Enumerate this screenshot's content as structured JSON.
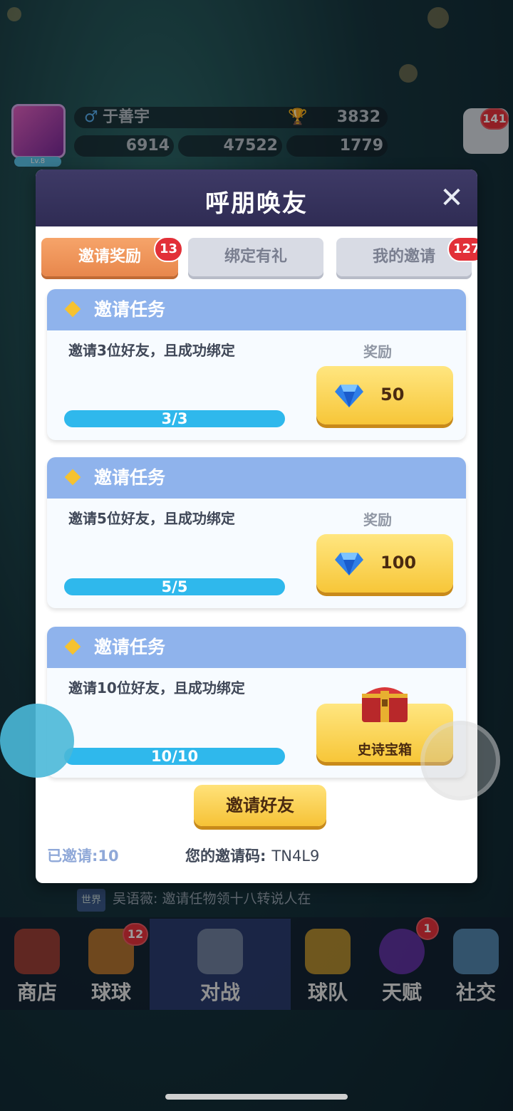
{
  "hud": {
    "player_name": "于善宇",
    "trophies": "3832",
    "level": "Lv.8",
    "currency1": "6914",
    "currency2": "47522",
    "gems": "1779",
    "menu_badge": "141"
  },
  "modal": {
    "title": "呼朋唤友",
    "close_icon": "close-icon",
    "tabs": [
      {
        "label": "邀请奖励",
        "badge": "13",
        "active": true
      },
      {
        "label": "绑定有礼",
        "badge": "",
        "active": false
      },
      {
        "label": "我的邀请",
        "badge": "127",
        "active": false
      }
    ],
    "tasks": [
      {
        "title": "邀请任务",
        "desc": "邀请3位好友，且成功绑定",
        "reward_label": "奖励",
        "progress": "3/3",
        "progress_fraction": 1.0,
        "reward_amount": "50",
        "reward_icon": "gem-icon"
      },
      {
        "title": "邀请任务",
        "desc": "邀请5位好友，且成功绑定",
        "reward_label": "奖励",
        "progress": "5/5",
        "progress_fraction": 1.0,
        "reward_amount": "100",
        "reward_icon": "gem-icon"
      },
      {
        "title": "邀请任务",
        "desc": "邀请10位好友，且成功绑定",
        "reward_label": "",
        "progress": "10/10",
        "progress_fraction": 1.0,
        "reward_amount": "史诗宝箱",
        "reward_icon": "chest-icon"
      }
    ],
    "invite_button": "邀请好友",
    "invited_label": "已邀请:10",
    "invite_code_label": "您的邀请码:",
    "invite_code": "TN4L9"
  },
  "chat": {
    "tag": "世界",
    "text": "吴语薇: 邀请任物领十八转说人在"
  },
  "nav": [
    {
      "label": "商店",
      "badge": ""
    },
    {
      "label": "球球",
      "badge": "12"
    },
    {
      "label": "对战",
      "badge": ""
    },
    {
      "label": "球队",
      "badge": ""
    },
    {
      "label": "天赋",
      "badge": "1"
    },
    {
      "label": "社交",
      "badge": ""
    }
  ],
  "colors": {
    "accent_orange": "#e8874c",
    "card_header": "#8fb3ec",
    "progress": "#2fb8ec",
    "button_gold": "#f7c638",
    "badge_red": "#e23038"
  }
}
